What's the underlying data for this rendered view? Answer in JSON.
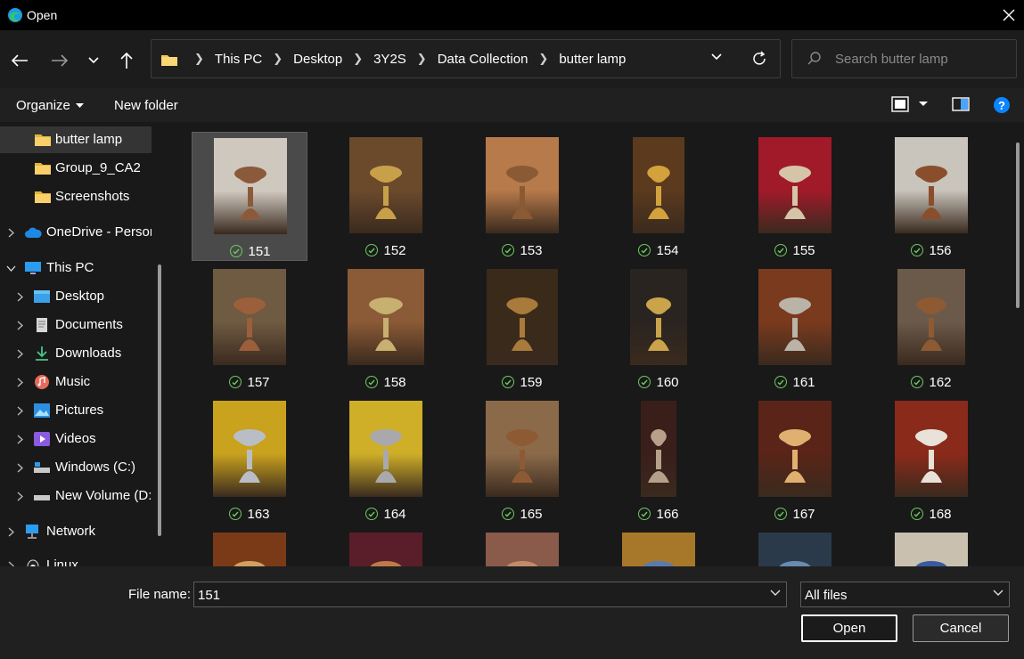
{
  "window": {
    "title": "Open"
  },
  "address": {
    "crumbs": [
      "This PC",
      "Desktop",
      "3Y2S",
      "Data Collection",
      "butter lamp"
    ]
  },
  "search": {
    "placeholder": "Search butter lamp"
  },
  "toolbar": {
    "organize": "Organize",
    "new_folder": "New folder"
  },
  "sidebar": {
    "items": [
      {
        "label": "butter lamp",
        "icon": "folder-icon",
        "selected": true
      },
      {
        "label": "Group_9_CA2",
        "icon": "folder-icon"
      },
      {
        "label": "Screenshots",
        "icon": "folder-icon"
      },
      {
        "label": "OneDrive - Person",
        "icon": "cloud-icon"
      },
      {
        "label": "This PC",
        "icon": "computer-icon"
      },
      {
        "label": "Desktop",
        "icon": "desktop-icon"
      },
      {
        "label": "Documents",
        "icon": "document-icon"
      },
      {
        "label": "Downloads",
        "icon": "download-icon"
      },
      {
        "label": "Music",
        "icon": "music-icon"
      },
      {
        "label": "Pictures",
        "icon": "picture-icon"
      },
      {
        "label": "Videos",
        "icon": "video-icon"
      },
      {
        "label": "Windows (C:)",
        "icon": "drive-icon"
      },
      {
        "label": "New Volume (D:",
        "icon": "drive-icon"
      },
      {
        "label": "Network",
        "icon": "network-icon"
      },
      {
        "label": "Linux",
        "icon": "linux-icon"
      }
    ]
  },
  "files": [
    {
      "name": "151",
      "bg": "#cfc8bf",
      "accent": "#8b5a3a"
    },
    {
      "name": "152",
      "bg": "#6b4a2c",
      "accent": "#c8a04a"
    },
    {
      "name": "153",
      "bg": "#b77a4a",
      "accent": "#8a5a35"
    },
    {
      "name": "154",
      "bg": "#5b3a1e",
      "accent": "#d3a23c"
    },
    {
      "name": "155",
      "bg": "#a11a2a",
      "accent": "#d6c4a8"
    },
    {
      "name": "156",
      "bg": "#c9c4bc",
      "accent": "#8a4e2c"
    },
    {
      "name": "157",
      "bg": "#6f5a42",
      "accent": "#9b5f3b"
    },
    {
      "name": "158",
      "bg": "#8b5a36",
      "accent": "#c7b070"
    },
    {
      "name": "159",
      "bg": "#3a2a1a",
      "accent": "#a87a3b"
    },
    {
      "name": "160",
      "bg": "#2a2420",
      "accent": "#caa34a"
    },
    {
      "name": "161",
      "bg": "#7a3a1e",
      "accent": "#b9b3a8"
    },
    {
      "name": "162",
      "bg": "#6b5a4a",
      "accent": "#8e5a34"
    },
    {
      "name": "163",
      "bg": "#c9a21e",
      "accent": "#b9bec6"
    },
    {
      "name": "164",
      "bg": "#cfae28",
      "accent": "#a9a9ad"
    },
    {
      "name": "165",
      "bg": "#8b6a4a",
      "accent": "#8e5a34"
    },
    {
      "name": "166",
      "bg": "#3a1e1a",
      "accent": "#b7a08a"
    },
    {
      "name": "167",
      "bg": "#5a2418",
      "accent": "#e0b070"
    },
    {
      "name": "168",
      "bg": "#8a2a1a",
      "accent": "#e8e2d8"
    },
    {
      "name": "",
      "bg": "#7a3a18",
      "accent": "#d0a060"
    },
    {
      "name": "",
      "bg": "#5a1e2a",
      "accent": "#c07a4a"
    },
    {
      "name": "",
      "bg": "#8a5a4a",
      "accent": "#c28a6a"
    },
    {
      "name": "",
      "bg": "#a8782a",
      "accent": "#5a7ab0"
    },
    {
      "name": "",
      "bg": "#2a3a4a",
      "accent": "#6a8ab0"
    },
    {
      "name": "",
      "bg": "#c9c0b0",
      "accent": "#3a5aa0"
    }
  ],
  "bottom": {
    "file_name_label": "File name:",
    "file_name_value": "151",
    "file_type": "All files",
    "open_label": "Open",
    "cancel_label": "Cancel"
  },
  "colors": {
    "accent": "#0a84ff",
    "check": "#6ccb5f",
    "folder": "#f2c94c"
  }
}
